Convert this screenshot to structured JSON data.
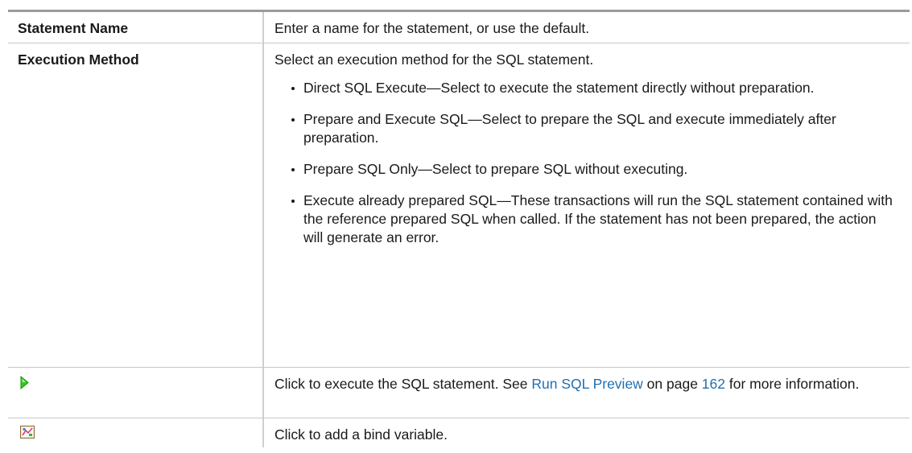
{
  "rows": [
    {
      "label": "Statement Name",
      "description": "Enter a name for the statement, or use the default."
    },
    {
      "label": "Execution Method",
      "description": "Select an execution method for the SQL statement.",
      "bullets": [
        "Direct SQL Execute—Select to execute the statement directly without preparation.",
        "Prepare and Execute SQL—Select to prepare the SQL and execute immediately after preparation.",
        "Prepare SQL Only—Select to prepare SQL without executing.",
        "Execute already prepared SQL—These transactions will run the SQL statement contained with the reference prepared SQL when called. If the statement has not been prepared, the action will generate an error."
      ]
    },
    {
      "icon": "execute-play-icon",
      "description_pre": "Click to execute the SQL statement. See ",
      "link_text": "Run SQL Preview",
      "description_mid": " on page ",
      "page_number": "162",
      "description_post": " for more information."
    },
    {
      "icon": "bind-variable-icon",
      "description": "Click to add a bind variable."
    }
  ],
  "colors": {
    "link": "#1f6fb2",
    "play_icon": "#2ecc1a"
  }
}
